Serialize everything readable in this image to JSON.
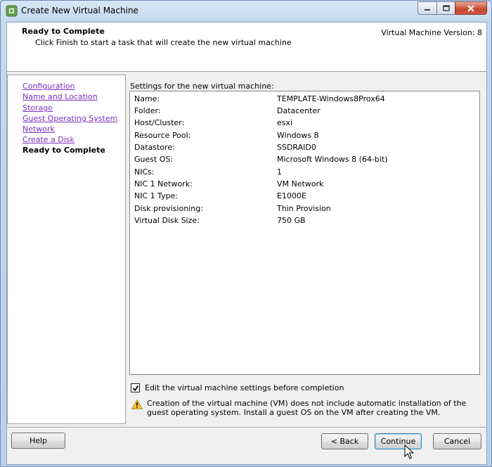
{
  "window": {
    "title": "Create New Virtual Machine",
    "app_icon": "vsphere-app-icon",
    "controls": [
      "minimize-icon",
      "maximize-icon",
      "close-icon"
    ]
  },
  "header": {
    "title": "Ready to Complete",
    "subtitle": "Click Finish to start a task that will create the new virtual machine",
    "version": "Virtual Machine Version: 8"
  },
  "steps": [
    {
      "label": "Configuration",
      "current": false
    },
    {
      "label": "Name and Location",
      "current": false
    },
    {
      "label": "Storage",
      "current": false
    },
    {
      "label": "Guest Operating System",
      "current": false
    },
    {
      "label": "Network",
      "current": false
    },
    {
      "label": "Create a Disk",
      "current": false
    },
    {
      "label": "Ready to Complete",
      "current": true
    }
  ],
  "settings": {
    "label": "Settings for the new virtual machine:",
    "rows": [
      {
        "key": "Name:",
        "value": "TEMPLATE-Windows8Prox64"
      },
      {
        "key": "Folder:",
        "value": "Datacenter"
      },
      {
        "key": "Host/Cluster:",
        "value": "esxi"
      },
      {
        "key": "Resource Pool:",
        "value": "Windows 8"
      },
      {
        "key": "Datastore:",
        "value": "SSDRAID0"
      },
      {
        "key": "Guest OS:",
        "value": "Microsoft Windows 8 (64-bit)"
      },
      {
        "key": "NICs:",
        "value": "1"
      },
      {
        "key": "NIC 1 Network:",
        "value": "VM Network"
      },
      {
        "key": "NIC 1 Type:",
        "value": "E1000E"
      },
      {
        "key": "Disk provisioning:",
        "value": "Thin Provision"
      },
      {
        "key": "Virtual Disk Size:",
        "value": "750 GB"
      }
    ]
  },
  "edit_checkbox": {
    "label": "Edit the virtual machine settings before completion",
    "checked": true
  },
  "warning": {
    "icon": "warning-icon",
    "text": "Creation of the virtual machine (VM) does not include automatic installation of the guest operating system. Install a guest OS on the VM after creating the VM."
  },
  "buttons": {
    "help": "Help",
    "back": "< Back",
    "continue": "Continue",
    "cancel": "Cancel"
  }
}
